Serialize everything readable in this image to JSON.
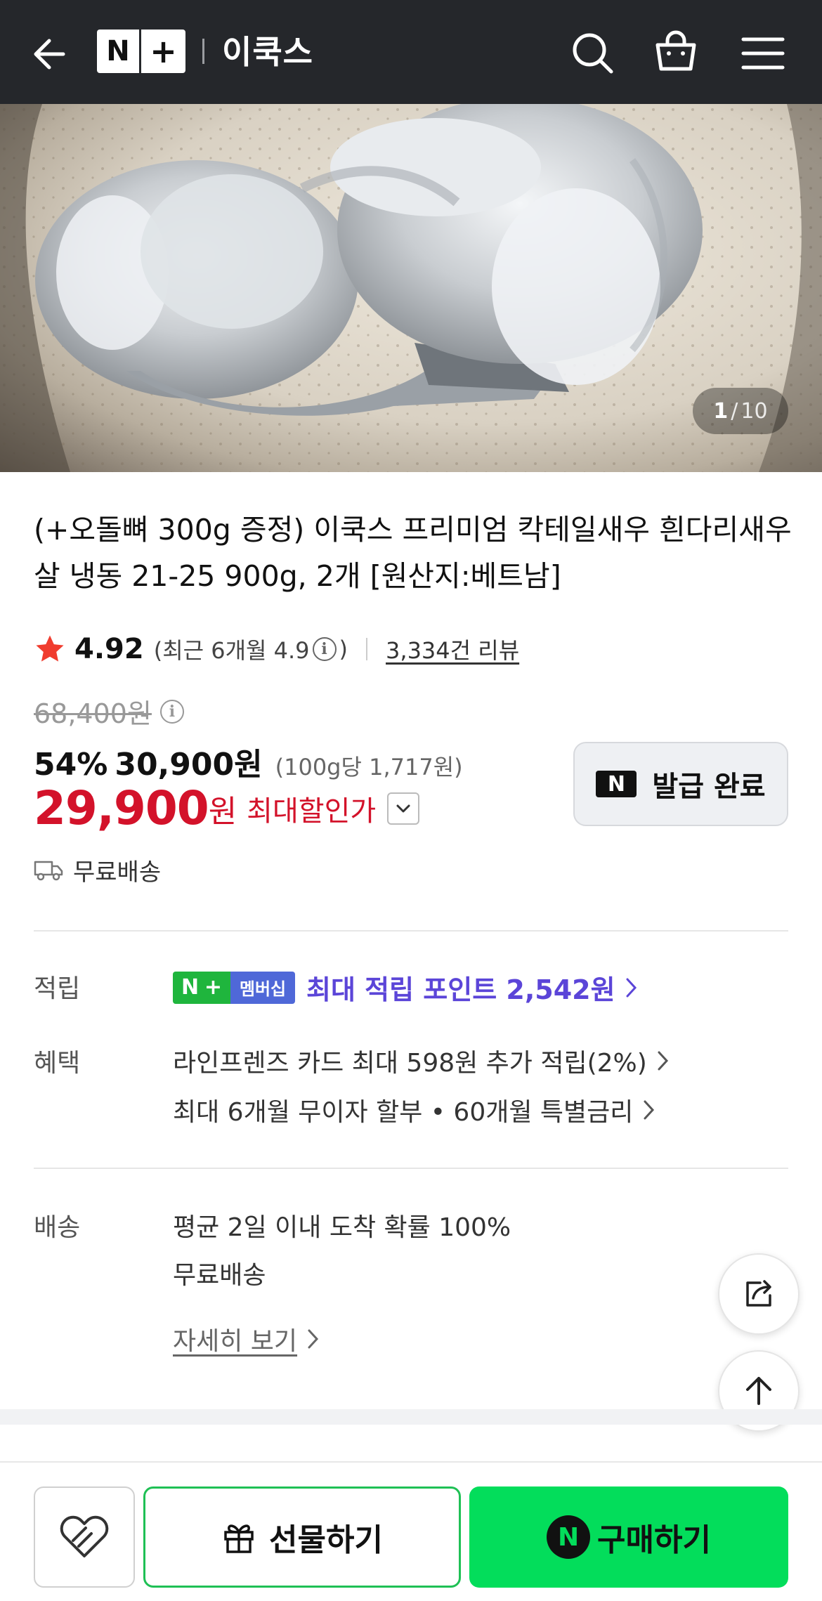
{
  "header": {
    "logo_n": "N",
    "logo_plus": "+",
    "brand": "이쿡스",
    "icons": [
      "back-arrow-icon",
      "search-icon",
      "shopping-bag-icon",
      "menu-icon"
    ]
  },
  "gallery": {
    "current": "1",
    "separator": "/",
    "total": "10"
  },
  "product": {
    "title": "(+오돌뼈 300g 증정) 이쿡스 프리미엄 칵테일새우 흰다리새우살 냉동 21-25 900g, 2개 [원산지:베트남]",
    "rating": "4.92",
    "recent_prefix": "(최근 6개월 4.9",
    "recent_suffix": ")",
    "reviews": "3,334건 리뷰"
  },
  "price": {
    "original": "68,400원",
    "discount_pct": "54%",
    "sale_price": "30,900원",
    "unit_price": "(100g당 1,717원)",
    "final_number": "29,900",
    "final_won": "원",
    "final_label": "최대할인가",
    "coupon_badge": "N",
    "coupon_label": "발급 완료",
    "free_shipping": "무료배송"
  },
  "benefits": {
    "points_label": "적립",
    "membership_n": "N",
    "membership_plus": "+",
    "membership_text": "멤버십",
    "points_text": "최대 적립 포인트 2,542원",
    "benefit_label": "혜택",
    "card_text": "라인프렌즈 카드 최대 598원 추가 적립(2%)",
    "installment_text": "최대 6개월 무이자 할부 • 60개월 특별금리"
  },
  "delivery": {
    "label": "배송",
    "arrival": "평균 2일 이내 도착 확률 100%",
    "fee": "무료배송",
    "more": "자세히 보기"
  },
  "bottom_bar": {
    "gift_label": "선물하기",
    "buy_badge": "N",
    "buy_label": "구매하기"
  },
  "colors": {
    "header_bg": "#25272b",
    "price_red": "#d3122a",
    "points_purple": "#5b45d8",
    "naver_green": "#03dd5b"
  }
}
